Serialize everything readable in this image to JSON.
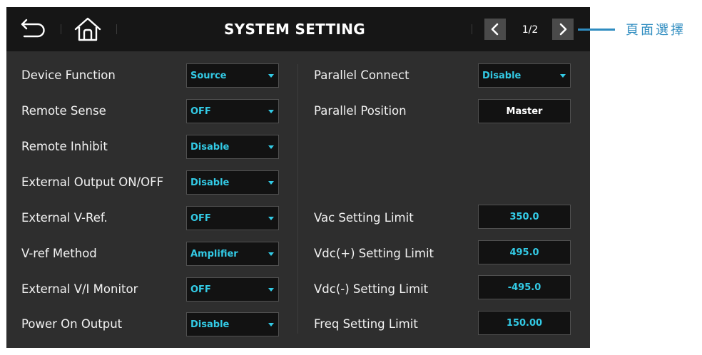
{
  "header": {
    "title": "SYSTEM SETTING",
    "page": "1/2"
  },
  "annotation": {
    "text": "頁面選擇"
  },
  "left_settings": [
    {
      "label": "Device Function",
      "value": "Source"
    },
    {
      "label": "Remote Sense",
      "value": "OFF"
    },
    {
      "label": "Remote Inhibit",
      "value": "Disable"
    },
    {
      "label": "External Output ON/OFF",
      "value": "Disable"
    },
    {
      "label": "External V-Ref.",
      "value": "OFF"
    },
    {
      "label": "V-ref Method",
      "value": "Amplifier"
    },
    {
      "label": "External V/I Monitor",
      "value": "OFF"
    },
    {
      "label": "Power On Output",
      "value": "Disable"
    }
  ],
  "right_settings": {
    "parallel_connect": {
      "label": "Parallel Connect",
      "value": "Disable"
    },
    "parallel_position": {
      "label": "Parallel Position",
      "value": "Master"
    },
    "vac_limit": {
      "label": "Vac Setting Limit",
      "value": "350.0"
    },
    "vdc_pos_limit": {
      "label": "Vdc(+) Setting Limit",
      "value": "495.0"
    },
    "vdc_neg_limit": {
      "label": "Vdc(-) Setting Limit",
      "value": "-495.0"
    },
    "freq_limit": {
      "label": "Freq Setting Limit",
      "value": "150.00"
    }
  },
  "colors": {
    "screen_bg": "#2e2e2e",
    "topbar_bg": "#161616",
    "value_accent": "#33cbe6",
    "annotation": "#2f8cc0"
  },
  "icons": {
    "back": "back-arrow-icon",
    "home": "home-icon",
    "prev": "chevron-left-icon",
    "next": "chevron-right-icon"
  }
}
